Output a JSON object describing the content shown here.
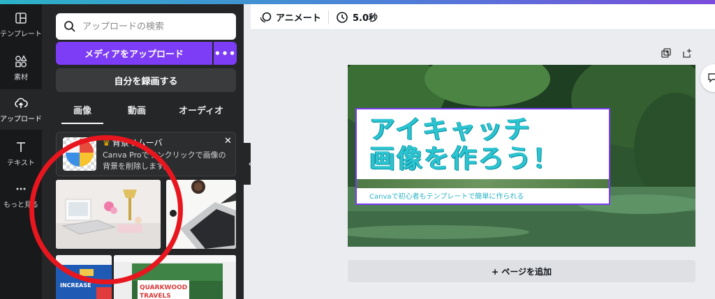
{
  "rail": {
    "items": [
      {
        "label": "テンプレート",
        "icon": "template-icon"
      },
      {
        "label": "素材",
        "icon": "elements-icon"
      },
      {
        "label": "アップロード",
        "icon": "upload-cloud-icon"
      },
      {
        "label": "テキスト",
        "icon": "text-icon"
      },
      {
        "label": "もっと見る",
        "icon": "more-dots-icon"
      }
    ]
  },
  "panel": {
    "search_placeholder": "アップロードの検索",
    "upload_button": "メディアをアップロード",
    "more_button": "•••",
    "record_button": "自分を録画する",
    "tabs": [
      "画像",
      "動画",
      "オーディオ"
    ],
    "promo": {
      "title": "背景リムーバ",
      "description": "Canva Proでワンクリックで画像の背景を削除します。",
      "close": "✕"
    },
    "thumbnails": {
      "thumb3_banner": "INCREASE",
      "thumb4_title_line1": "QUARKWOOD",
      "thumb4_title_line2": "TRAVELS"
    }
  },
  "toolbar": {
    "animate_label": "アニメート",
    "duration_label": "5.0秒"
  },
  "design": {
    "title_line1": "アイキャッチ",
    "title_line2": "画像を作ろう！",
    "subtitle": "Canvaで初心者もテンプレートで簡単に作られる"
  },
  "add_page_label": "+ ページを追加",
  "colors": {
    "accent": "#7d3cf6",
    "panel": "#252627",
    "rail": "#18191b",
    "title_text": "#2bc5d1",
    "annotation": "#e8161e"
  }
}
